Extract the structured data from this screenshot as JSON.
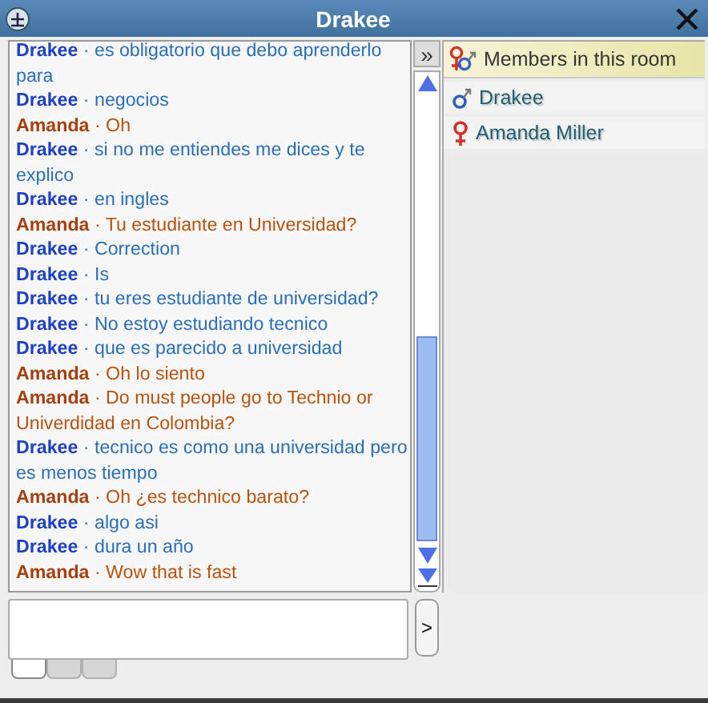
{
  "window": {
    "title": "Drakee"
  },
  "messages": [
    {
      "text": "**Drakee** · es obligatorio que debo aprenderlo para",
      "color": "#2a6fb5"
    },
    {
      "text": "**Drakee** · negocios",
      "color": "#2a6fb5"
    },
    {
      "text": "**Amanda** · Oh",
      "color": "#b8520f"
    },
    {
      "text": "**Drakee** · si no me entiendes me dices y te explico",
      "color": "#2a6fb5"
    },
    {
      "text": "**Drakee** · en ingles",
      "color": "#2a6fb5"
    },
    {
      "text": "**Amanda** · Tu estudiante en Universidad?",
      "color": "#b8520f"
    },
    {
      "text": "**Drakee** · Correction",
      "color": "#2a6fb5"
    },
    {
      "text": "**Drakee** · Is",
      "color": "#2a6fb5"
    },
    {
      "text": "**Drakee** · tu eres estudiante de universidad?",
      "color": "#2a6fb5"
    },
    {
      "text": "**Drakee** · No estoy estudiando tecnico",
      "color": "#2a6fb5"
    },
    {
      "text": "**Drakee** · que es parecido a universidad",
      "color": "#2a6fb5"
    },
    {
      "text": "**Amanda** · Oh lo siento",
      "color": "#b8520f"
    },
    {
      "text": "**Amanda** · Do must people go to Technio or Univerdidad en Colombia?",
      "color": "#b8520f"
    },
    {
      "text": "**Drakee** · tecnico es como una universidad pero es menos tiempo",
      "color": "#2a6fb5"
    },
    {
      "text": "**Amanda** · Oh ¿es technico barato?",
      "color": "#b8520f"
    },
    {
      "text": "**Drakee** · algo asi",
      "color": "#2a6fb5"
    },
    {
      "text": "**Drakee** · dura un año",
      "color": "#2a6fb5"
    },
    {
      "text": "**Amanda** · Wow that is fast",
      "color": "#b8520f"
    }
  ],
  "members": {
    "title": "Members in this room",
    "items": [
      {
        "name": "Drakee",
        "kind": "male"
      },
      {
        "name": "Amanda Miller",
        "kind": "female"
      }
    ]
  },
  "input_tabs": [
    {
      "selected": true
    },
    {
      "selected": false
    },
    {
      "selected": false
    }
  ],
  "collapse_button": "»",
  "send_button": ">"
}
